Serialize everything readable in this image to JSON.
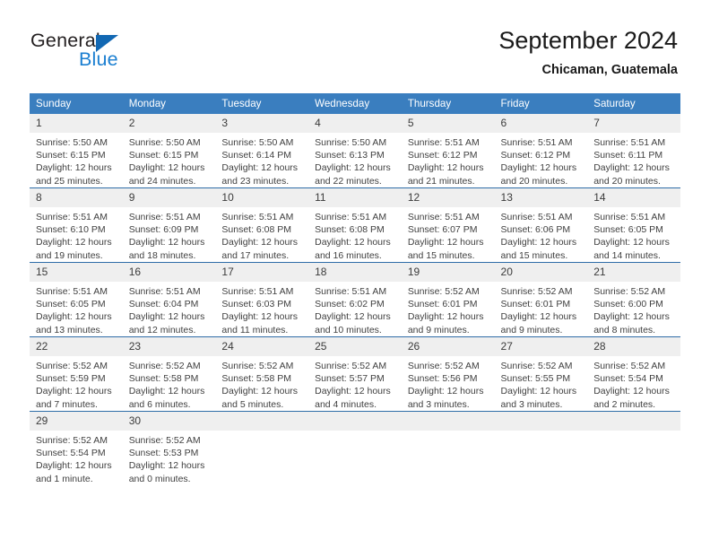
{
  "logo": {
    "word_top": "General",
    "word_bottom": "Blue",
    "triangle_color": "#1268b3",
    "blue_color": "#1b7fd1"
  },
  "header": {
    "title": "September 2024",
    "subtitle": "Chicaman, Guatemala"
  },
  "theme": {
    "header_bg": "#3a7ebf",
    "row_divider": "#2f6da8",
    "daynum_bg": "#efefef",
    "text": "#404040"
  },
  "weekdays": [
    "Sunday",
    "Monday",
    "Tuesday",
    "Wednesday",
    "Thursday",
    "Friday",
    "Saturday"
  ],
  "labels": {
    "sunrise": "Sunrise:",
    "sunset": "Sunset:",
    "daylight": "Daylight:"
  },
  "weeks": [
    [
      {
        "day": "1",
        "sunrise": "Sunrise: 5:50 AM",
        "sunset": "Sunset: 6:15 PM",
        "daylight1": "Daylight: 12 hours",
        "daylight2": "and 25 minutes."
      },
      {
        "day": "2",
        "sunrise": "Sunrise: 5:50 AM",
        "sunset": "Sunset: 6:15 PM",
        "daylight1": "Daylight: 12 hours",
        "daylight2": "and 24 minutes."
      },
      {
        "day": "3",
        "sunrise": "Sunrise: 5:50 AM",
        "sunset": "Sunset: 6:14 PM",
        "daylight1": "Daylight: 12 hours",
        "daylight2": "and 23 minutes."
      },
      {
        "day": "4",
        "sunrise": "Sunrise: 5:50 AM",
        "sunset": "Sunset: 6:13 PM",
        "daylight1": "Daylight: 12 hours",
        "daylight2": "and 22 minutes."
      },
      {
        "day": "5",
        "sunrise": "Sunrise: 5:51 AM",
        "sunset": "Sunset: 6:12 PM",
        "daylight1": "Daylight: 12 hours",
        "daylight2": "and 21 minutes."
      },
      {
        "day": "6",
        "sunrise": "Sunrise: 5:51 AM",
        "sunset": "Sunset: 6:12 PM",
        "daylight1": "Daylight: 12 hours",
        "daylight2": "and 20 minutes."
      },
      {
        "day": "7",
        "sunrise": "Sunrise: 5:51 AM",
        "sunset": "Sunset: 6:11 PM",
        "daylight1": "Daylight: 12 hours",
        "daylight2": "and 20 minutes."
      }
    ],
    [
      {
        "day": "8",
        "sunrise": "Sunrise: 5:51 AM",
        "sunset": "Sunset: 6:10 PM",
        "daylight1": "Daylight: 12 hours",
        "daylight2": "and 19 minutes."
      },
      {
        "day": "9",
        "sunrise": "Sunrise: 5:51 AM",
        "sunset": "Sunset: 6:09 PM",
        "daylight1": "Daylight: 12 hours",
        "daylight2": "and 18 minutes."
      },
      {
        "day": "10",
        "sunrise": "Sunrise: 5:51 AM",
        "sunset": "Sunset: 6:08 PM",
        "daylight1": "Daylight: 12 hours",
        "daylight2": "and 17 minutes."
      },
      {
        "day": "11",
        "sunrise": "Sunrise: 5:51 AM",
        "sunset": "Sunset: 6:08 PM",
        "daylight1": "Daylight: 12 hours",
        "daylight2": "and 16 minutes."
      },
      {
        "day": "12",
        "sunrise": "Sunrise: 5:51 AM",
        "sunset": "Sunset: 6:07 PM",
        "daylight1": "Daylight: 12 hours",
        "daylight2": "and 15 minutes."
      },
      {
        "day": "13",
        "sunrise": "Sunrise: 5:51 AM",
        "sunset": "Sunset: 6:06 PM",
        "daylight1": "Daylight: 12 hours",
        "daylight2": "and 15 minutes."
      },
      {
        "day": "14",
        "sunrise": "Sunrise: 5:51 AM",
        "sunset": "Sunset: 6:05 PM",
        "daylight1": "Daylight: 12 hours",
        "daylight2": "and 14 minutes."
      }
    ],
    [
      {
        "day": "15",
        "sunrise": "Sunrise: 5:51 AM",
        "sunset": "Sunset: 6:05 PM",
        "daylight1": "Daylight: 12 hours",
        "daylight2": "and 13 minutes."
      },
      {
        "day": "16",
        "sunrise": "Sunrise: 5:51 AM",
        "sunset": "Sunset: 6:04 PM",
        "daylight1": "Daylight: 12 hours",
        "daylight2": "and 12 minutes."
      },
      {
        "day": "17",
        "sunrise": "Sunrise: 5:51 AM",
        "sunset": "Sunset: 6:03 PM",
        "daylight1": "Daylight: 12 hours",
        "daylight2": "and 11 minutes."
      },
      {
        "day": "18",
        "sunrise": "Sunrise: 5:51 AM",
        "sunset": "Sunset: 6:02 PM",
        "daylight1": "Daylight: 12 hours",
        "daylight2": "and 10 minutes."
      },
      {
        "day": "19",
        "sunrise": "Sunrise: 5:52 AM",
        "sunset": "Sunset: 6:01 PM",
        "daylight1": "Daylight: 12 hours",
        "daylight2": "and 9 minutes."
      },
      {
        "day": "20",
        "sunrise": "Sunrise: 5:52 AM",
        "sunset": "Sunset: 6:01 PM",
        "daylight1": "Daylight: 12 hours",
        "daylight2": "and 9 minutes."
      },
      {
        "day": "21",
        "sunrise": "Sunrise: 5:52 AM",
        "sunset": "Sunset: 6:00 PM",
        "daylight1": "Daylight: 12 hours",
        "daylight2": "and 8 minutes."
      }
    ],
    [
      {
        "day": "22",
        "sunrise": "Sunrise: 5:52 AM",
        "sunset": "Sunset: 5:59 PM",
        "daylight1": "Daylight: 12 hours",
        "daylight2": "and 7 minutes."
      },
      {
        "day": "23",
        "sunrise": "Sunrise: 5:52 AM",
        "sunset": "Sunset: 5:58 PM",
        "daylight1": "Daylight: 12 hours",
        "daylight2": "and 6 minutes."
      },
      {
        "day": "24",
        "sunrise": "Sunrise: 5:52 AM",
        "sunset": "Sunset: 5:58 PM",
        "daylight1": "Daylight: 12 hours",
        "daylight2": "and 5 minutes."
      },
      {
        "day": "25",
        "sunrise": "Sunrise: 5:52 AM",
        "sunset": "Sunset: 5:57 PM",
        "daylight1": "Daylight: 12 hours",
        "daylight2": "and 4 minutes."
      },
      {
        "day": "26",
        "sunrise": "Sunrise: 5:52 AM",
        "sunset": "Sunset: 5:56 PM",
        "daylight1": "Daylight: 12 hours",
        "daylight2": "and 3 minutes."
      },
      {
        "day": "27",
        "sunrise": "Sunrise: 5:52 AM",
        "sunset": "Sunset: 5:55 PM",
        "daylight1": "Daylight: 12 hours",
        "daylight2": "and 3 minutes."
      },
      {
        "day": "28",
        "sunrise": "Sunrise: 5:52 AM",
        "sunset": "Sunset: 5:54 PM",
        "daylight1": "Daylight: 12 hours",
        "daylight2": "and 2 minutes."
      }
    ],
    [
      {
        "day": "29",
        "sunrise": "Sunrise: 5:52 AM",
        "sunset": "Sunset: 5:54 PM",
        "daylight1": "Daylight: 12 hours",
        "daylight2": "and 1 minute."
      },
      {
        "day": "30",
        "sunrise": "Sunrise: 5:52 AM",
        "sunset": "Sunset: 5:53 PM",
        "daylight1": "Daylight: 12 hours",
        "daylight2": "and 0 minutes."
      },
      {
        "day": "",
        "sunrise": "",
        "sunset": "",
        "daylight1": "",
        "daylight2": ""
      },
      {
        "day": "",
        "sunrise": "",
        "sunset": "",
        "daylight1": "",
        "daylight2": ""
      },
      {
        "day": "",
        "sunrise": "",
        "sunset": "",
        "daylight1": "",
        "daylight2": ""
      },
      {
        "day": "",
        "sunrise": "",
        "sunset": "",
        "daylight1": "",
        "daylight2": ""
      },
      {
        "day": "",
        "sunrise": "",
        "sunset": "",
        "daylight1": "",
        "daylight2": ""
      }
    ]
  ]
}
